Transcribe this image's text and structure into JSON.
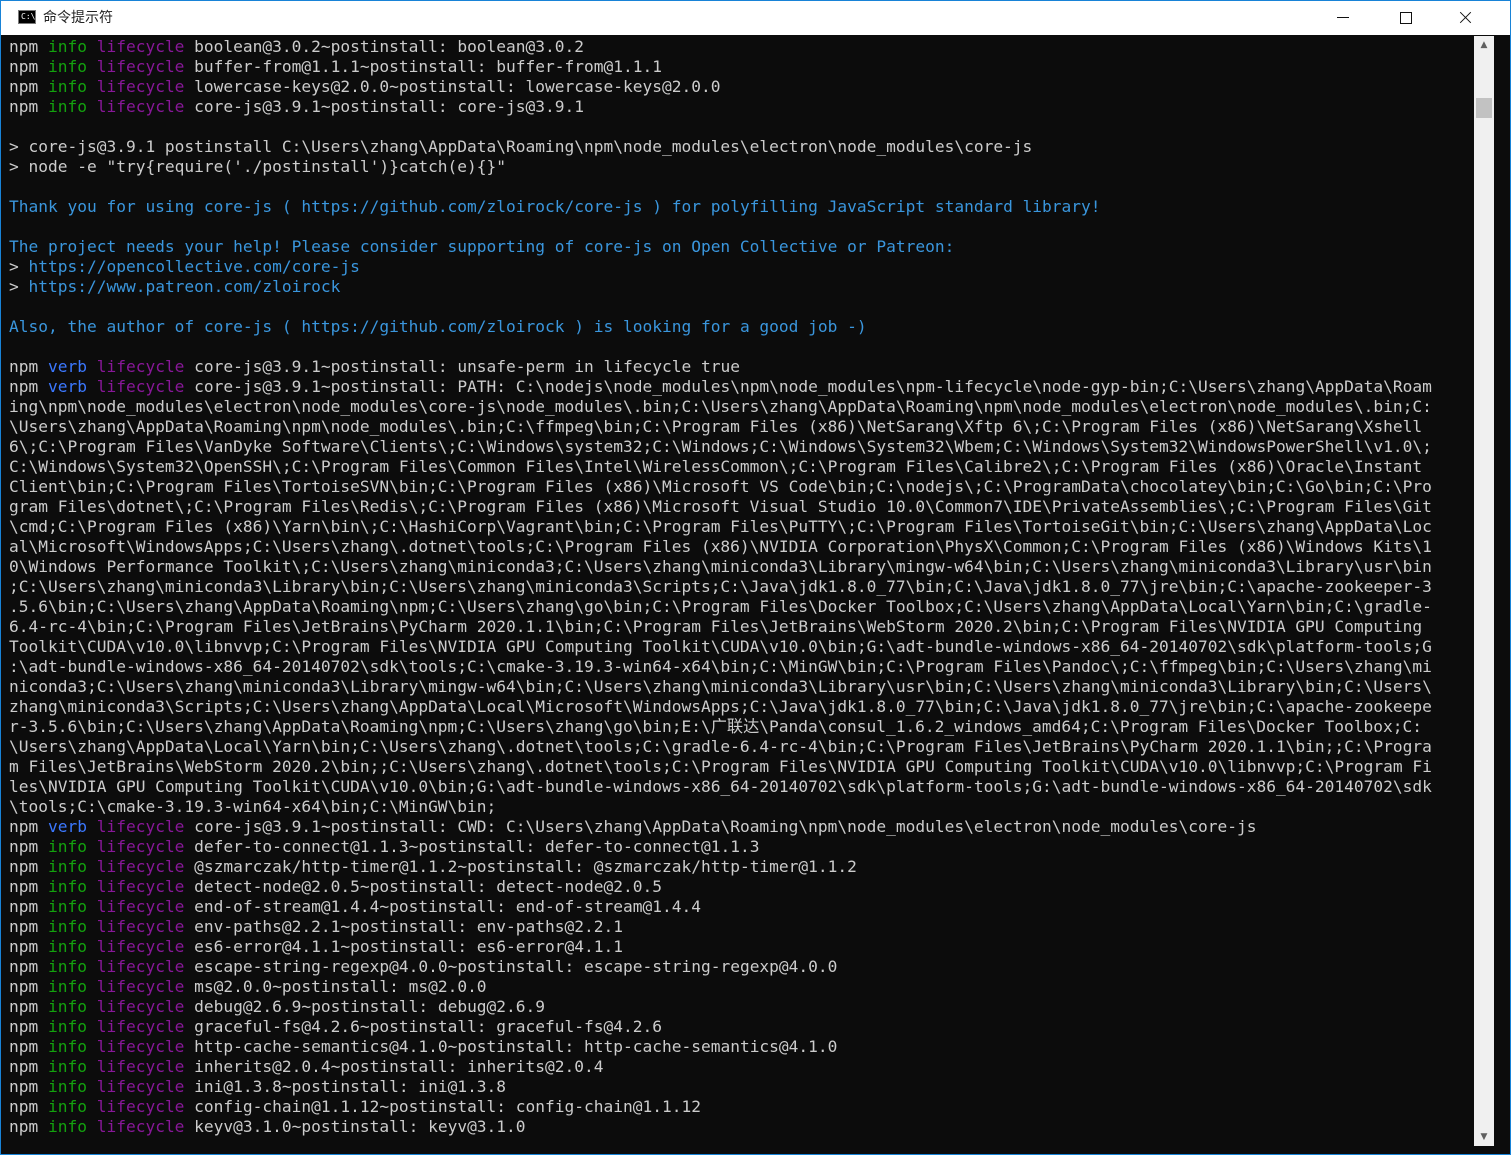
{
  "window": {
    "title": "命令提示符",
    "icon_text": "C:\\"
  },
  "controls": {
    "minimize": "minimize",
    "maximize": "maximize",
    "close": "close"
  },
  "colors": {
    "info": "#13a10e",
    "verb": "#3b78ff",
    "lifecycle": "#881798",
    "cyan": "#3a96dd",
    "text": "#cccccc",
    "background": "#0c0c0c"
  },
  "lines": [
    [
      "npm ",
      [
        "info",
        "info"
      ],
      " ",
      [
        "life",
        "lifecycle"
      ],
      " boolean@3.0.2~postinstall: boolean@3.0.2"
    ],
    [
      "npm ",
      [
        "info",
        "info"
      ],
      " ",
      [
        "life",
        "lifecycle"
      ],
      " buffer-from@1.1.1~postinstall: buffer-from@1.1.1"
    ],
    [
      "npm ",
      [
        "info",
        "info"
      ],
      " ",
      [
        "life",
        "lifecycle"
      ],
      " lowercase-keys@2.0.0~postinstall: lowercase-keys@2.0.0"
    ],
    [
      "npm ",
      [
        "info",
        "info"
      ],
      " ",
      [
        "life",
        "lifecycle"
      ],
      " core-js@3.9.1~postinstall: core-js@3.9.1"
    ],
    [
      ""
    ],
    [
      "> core-js@3.9.1 postinstall C:\\Users\\zhang\\AppData\\Roaming\\npm\\node_modules\\electron\\node_modules\\core-js"
    ],
    [
      "> node -e \"try{require('./postinstall')}catch(e){}\""
    ],
    [
      ""
    ],
    [
      [
        "cyan",
        "Thank you for using core-js ( "
      ],
      [
        "cyan",
        "https://github.com/zloirock/core-js"
      ],
      [
        "cyan",
        " ) for polyfilling JavaScript standard library!"
      ]
    ],
    [
      ""
    ],
    [
      [
        "cyan",
        "The project needs your help! Please consider supporting of core-js on Open Collective or Patreon:"
      ]
    ],
    [
      "> ",
      [
        "cyan",
        "https://opencollective.com/core-js"
      ]
    ],
    [
      "> ",
      [
        "cyan",
        "https://www.patreon.com/zloirock"
      ]
    ],
    [
      ""
    ],
    [
      [
        "cyan",
        "Also, the author of core-js ( "
      ],
      [
        "cyan",
        "https://github.com/zloirock"
      ],
      [
        "cyan",
        " ) is looking for a good job -)"
      ]
    ],
    [
      ""
    ],
    [
      "npm ",
      [
        "verb",
        "verb"
      ],
      " ",
      [
        "life",
        "lifecycle"
      ],
      " core-js@3.9.1~postinstall: unsafe-perm in lifecycle true"
    ],
    [
      "npm ",
      [
        "verb",
        "verb"
      ],
      " ",
      [
        "life",
        "lifecycle"
      ],
      " core-js@3.9.1~postinstall: PATH: C:\\nodejs\\node_modules\\npm\\node_modules\\npm-lifecycle\\node-gyp-bin;C:\\Users\\zhang\\AppData\\Roam"
    ],
    [
      "ing\\npm\\node_modules\\electron\\node_modules\\core-js\\node_modules\\.bin;C:\\Users\\zhang\\AppData\\Roaming\\npm\\node_modules\\electron\\node_modules\\.bin;C:"
    ],
    [
      "\\Users\\zhang\\AppData\\Roaming\\npm\\node_modules\\.bin;C:\\ffmpeg\\bin;C:\\Program Files (x86)\\NetSarang\\Xftp 6\\;C:\\Program Files (x86)\\NetSarang\\Xshell"
    ],
    [
      "6\\;C:\\Program Files\\VanDyke Software\\Clients\\;C:\\Windows\\system32;C:\\Windows;C:\\Windows\\System32\\Wbem;C:\\Windows\\System32\\WindowsPowerShell\\v1.0\\;"
    ],
    [
      "C:\\Windows\\System32\\OpenSSH\\;C:\\Program Files\\Common Files\\Intel\\WirelessCommon\\;C:\\Program Files\\Calibre2\\;C:\\Program Files (x86)\\Oracle\\Instant"
    ],
    [
      "Client\\bin;C:\\Program Files\\TortoiseSVN\\bin;C:\\Program Files (x86)\\Microsoft VS Code\\bin;C:\\nodejs\\;C:\\ProgramData\\chocolatey\\bin;C:\\Go\\bin;C:\\Pro"
    ],
    [
      "gram Files\\dotnet\\;C:\\Program Files\\Redis\\;C:\\Program Files (x86)\\Microsoft Visual Studio 10.0\\Common7\\IDE\\PrivateAssemblies\\;C:\\Program Files\\Git"
    ],
    [
      "\\cmd;C:\\Program Files (x86)\\Yarn\\bin\\;C:\\HashiCorp\\Vagrant\\bin;C:\\Program Files\\PuTTY\\;C:\\Program Files\\TortoiseGit\\bin;C:\\Users\\zhang\\AppData\\Loc"
    ],
    [
      "al\\Microsoft\\WindowsApps;C:\\Users\\zhang\\.dotnet\\tools;C:\\Program Files (x86)\\NVIDIA Corporation\\PhysX\\Common;C:\\Program Files (x86)\\Windows Kits\\1"
    ],
    [
      "0\\Windows Performance Toolkit\\;C:\\Users\\zhang\\miniconda3;C:\\Users\\zhang\\miniconda3\\Library\\mingw-w64\\bin;C:\\Users\\zhang\\miniconda3\\Library\\usr\\bin"
    ],
    [
      ";C:\\Users\\zhang\\miniconda3\\Library\\bin;C:\\Users\\zhang\\miniconda3\\Scripts;C:\\Java\\jdk1.8.0_77\\bin;C:\\Java\\jdk1.8.0_77\\jre\\bin;C:\\apache-zookeeper-3"
    ],
    [
      ".5.6\\bin;C:\\Users\\zhang\\AppData\\Roaming\\npm;C:\\Users\\zhang\\go\\bin;C:\\Program Files\\Docker Toolbox;C:\\Users\\zhang\\AppData\\Local\\Yarn\\bin;C:\\gradle-"
    ],
    [
      "6.4-rc-4\\bin;C:\\Program Files\\JetBrains\\PyCharm 2020.1.1\\bin;C:\\Program Files\\JetBrains\\WebStorm 2020.2\\bin;C:\\Program Files\\NVIDIA GPU Computing"
    ],
    [
      "Toolkit\\CUDA\\v10.0\\libnvvp;C:\\Program Files\\NVIDIA GPU Computing Toolkit\\CUDA\\v10.0\\bin;G:\\adt-bundle-windows-x86_64-20140702\\sdk\\platform-tools;G"
    ],
    [
      ":\\adt-bundle-windows-x86_64-20140702\\sdk\\tools;C:\\cmake-3.19.3-win64-x64\\bin;C:\\MinGW\\bin;C:\\Program Files\\Pandoc\\;C:\\ffmpeg\\bin;C:\\Users\\zhang\\mi"
    ],
    [
      "niconda3;C:\\Users\\zhang\\miniconda3\\Library\\mingw-w64\\bin;C:\\Users\\zhang\\miniconda3\\Library\\usr\\bin;C:\\Users\\zhang\\miniconda3\\Library\\bin;C:\\Users\\"
    ],
    [
      "zhang\\miniconda3\\Scripts;C:\\Users\\zhang\\AppData\\Local\\Microsoft\\WindowsApps;C:\\Java\\jdk1.8.0_77\\bin;C:\\Java\\jdk1.8.0_77\\jre\\bin;C:\\apache-zookeepe"
    ],
    [
      "r-3.5.6\\bin;C:\\Users\\zhang\\AppData\\Roaming\\npm;C:\\Users\\zhang\\go\\bin;E:\\广联达\\Panda\\consul_1.6.2_windows_amd64;C:\\Program Files\\Docker Toolbox;C:"
    ],
    [
      "\\Users\\zhang\\AppData\\Local\\Yarn\\bin;C:\\Users\\zhang\\.dotnet\\tools;C:\\gradle-6.4-rc-4\\bin;C:\\Program Files\\JetBrains\\PyCharm 2020.1.1\\bin;;C:\\Progra"
    ],
    [
      "m Files\\JetBrains\\WebStorm 2020.2\\bin;;C:\\Users\\zhang\\.dotnet\\tools;C:\\Program Files\\NVIDIA GPU Computing Toolkit\\CUDA\\v10.0\\libnvvp;C:\\Program Fi"
    ],
    [
      "les\\NVIDIA GPU Computing Toolkit\\CUDA\\v10.0\\bin;G:\\adt-bundle-windows-x86_64-20140702\\sdk\\platform-tools;G:\\adt-bundle-windows-x86_64-20140702\\sdk"
    ],
    [
      "\\tools;C:\\cmake-3.19.3-win64-x64\\bin;C:\\MinGW\\bin;"
    ],
    [
      "npm ",
      [
        "verb",
        "verb"
      ],
      " ",
      [
        "life",
        "lifecycle"
      ],
      " core-js@3.9.1~postinstall: CWD: C:\\Users\\zhang\\AppData\\Roaming\\npm\\node_modules\\electron\\node_modules\\core-js"
    ],
    [
      "npm ",
      [
        "info",
        "info"
      ],
      " ",
      [
        "life",
        "lifecycle"
      ],
      " defer-to-connect@1.1.3~postinstall: defer-to-connect@1.1.3"
    ],
    [
      "npm ",
      [
        "info",
        "info"
      ],
      " ",
      [
        "life",
        "lifecycle"
      ],
      " @szmarczak/http-timer@1.1.2~postinstall: @szmarczak/http-timer@1.1.2"
    ],
    [
      "npm ",
      [
        "info",
        "info"
      ],
      " ",
      [
        "life",
        "lifecycle"
      ],
      " detect-node@2.0.5~postinstall: detect-node@2.0.5"
    ],
    [
      "npm ",
      [
        "info",
        "info"
      ],
      " ",
      [
        "life",
        "lifecycle"
      ],
      " end-of-stream@1.4.4~postinstall: end-of-stream@1.4.4"
    ],
    [
      "npm ",
      [
        "info",
        "info"
      ],
      " ",
      [
        "life",
        "lifecycle"
      ],
      " env-paths@2.2.1~postinstall: env-paths@2.2.1"
    ],
    [
      "npm ",
      [
        "info",
        "info"
      ],
      " ",
      [
        "life",
        "lifecycle"
      ],
      " es6-error@4.1.1~postinstall: es6-error@4.1.1"
    ],
    [
      "npm ",
      [
        "info",
        "info"
      ],
      " ",
      [
        "life",
        "lifecycle"
      ],
      " escape-string-regexp@4.0.0~postinstall: escape-string-regexp@4.0.0"
    ],
    [
      "npm ",
      [
        "info",
        "info"
      ],
      " ",
      [
        "life",
        "lifecycle"
      ],
      " ms@2.0.0~postinstall: ms@2.0.0"
    ],
    [
      "npm ",
      [
        "info",
        "info"
      ],
      " ",
      [
        "life",
        "lifecycle"
      ],
      " debug@2.6.9~postinstall: debug@2.6.9"
    ],
    [
      "npm ",
      [
        "info",
        "info"
      ],
      " ",
      [
        "life",
        "lifecycle"
      ],
      " graceful-fs@4.2.6~postinstall: graceful-fs@4.2.6"
    ],
    [
      "npm ",
      [
        "info",
        "info"
      ],
      " ",
      [
        "life",
        "lifecycle"
      ],
      " http-cache-semantics@4.1.0~postinstall: http-cache-semantics@4.1.0"
    ],
    [
      "npm ",
      [
        "info",
        "info"
      ],
      " ",
      [
        "life",
        "lifecycle"
      ],
      " inherits@2.0.4~postinstall: inherits@2.0.4"
    ],
    [
      "npm ",
      [
        "info",
        "info"
      ],
      " ",
      [
        "life",
        "lifecycle"
      ],
      " ini@1.3.8~postinstall: ini@1.3.8"
    ],
    [
      "npm ",
      [
        "info",
        "info"
      ],
      " ",
      [
        "life",
        "lifecycle"
      ],
      " config-chain@1.1.12~postinstall: config-chain@1.1.12"
    ],
    [
      "npm ",
      [
        "info",
        "info"
      ],
      " ",
      [
        "life",
        "lifecycle"
      ],
      " keyv@3.1.0~postinstall: keyv@3.1.0"
    ]
  ]
}
